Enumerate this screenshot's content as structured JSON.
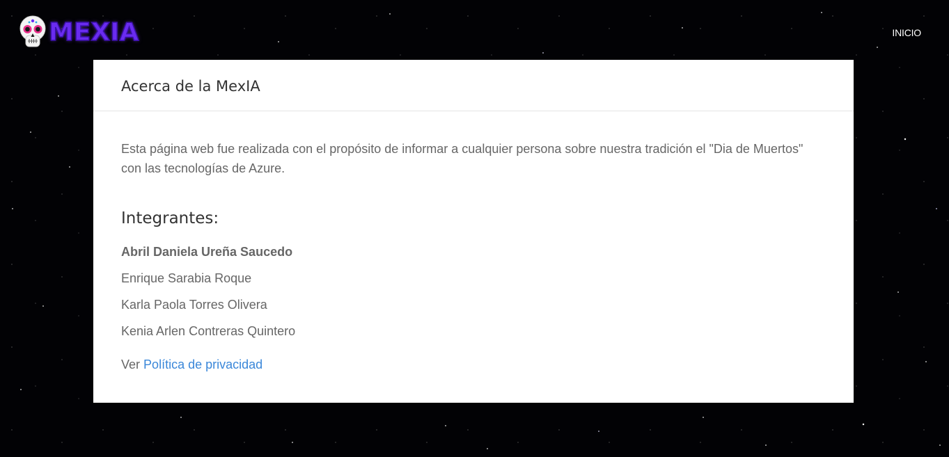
{
  "navbar": {
    "brand_text": "MEXIA",
    "brand_icon": "sugar-skull-icon",
    "brand_color": "#6a2cf0",
    "links": [
      {
        "label": "INICIO"
      }
    ]
  },
  "about": {
    "title": "Acerca de la MexIA",
    "description": "Esta página web fue realizada con el propósito de informar a cualquier persona sobre nuestra tradición el \"Dia de Muertos\" con las tecnologías de Azure.",
    "members_title": "Integrantes:",
    "members": [
      "Abril Daniela Ureña Saucedo",
      "Enrique Sarabia Roque",
      "Karla Paola Torres Olivera",
      "Kenia Arlen Contreras Quintero"
    ],
    "privacy_prefix": "Ver",
    "privacy_link": "Política de privacidad",
    "link_color": "#3a87d9"
  }
}
